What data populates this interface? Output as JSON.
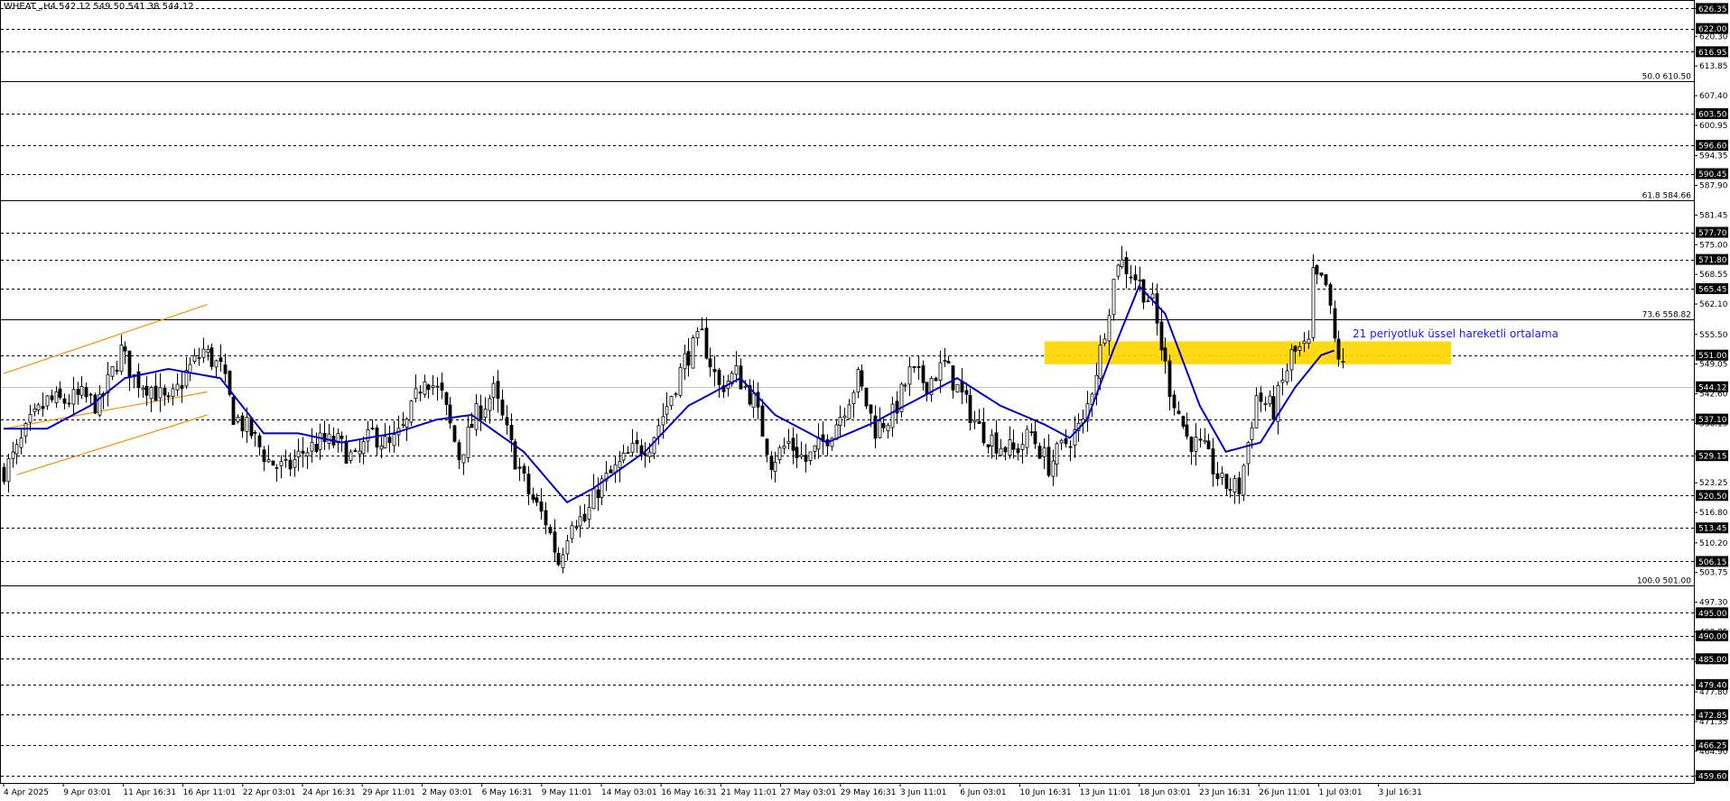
{
  "header": {
    "symbol_line": "WHEAT_,H4  542.12 549.50 541.38 544.12"
  },
  "annotation": {
    "text": "21 periyotluk üssel hareketli ortalama"
  },
  "colors": {
    "candle": "#000000",
    "ema": "#0000cc",
    "channel": "#ff8c00",
    "zone": "#ffd700",
    "grid_dashed": "#000000",
    "fib": "#000000",
    "price_tag_bg": "#000000",
    "price_tag_text": "#ffffff"
  },
  "chart_data": {
    "type": "candlestick",
    "title": "",
    "timeframe": "H4",
    "ylim": [
      458.0,
      628.0
    ],
    "y_ticks": [
      626.35,
      620.3,
      613.85,
      607.4,
      600.95,
      594.35,
      587.9,
      581.45,
      575.0,
      568.55,
      562.1,
      555.5,
      549.05,
      542.6,
      536.15,
      529.55,
      523.25,
      516.8,
      510.2,
      503.75,
      497.3,
      490.85,
      484.4,
      477.8,
      471.35,
      464.9,
      459.55
    ],
    "x_labels": [
      "4 Apr 2025",
      "9 Apr 03:01",
      "11 Apr 16:31",
      "16 Apr 11:01",
      "22 Apr 03:01",
      "24 Apr 16:31",
      "29 Apr 11:01",
      "2 May 03:01",
      "6 May 16:31",
      "9 May 11:01",
      "14 May 03:01",
      "16 May 16:31",
      "21 May 11:01",
      "27 May 03:01",
      "29 May 16:31",
      "3 Jun 11:01",
      "6 Jun 03:01",
      "10 Jun 16:31",
      "13 Jun 11:01",
      "18 Jun 03:01",
      "23 Jun 16:31",
      "26 Jun 11:01",
      "1 Jul 03:01",
      "3 Jul 16:31"
    ],
    "horizontal_levels": [
      626.35,
      622.0,
      616.95,
      603.5,
      596.6,
      590.45,
      577.7,
      571.8,
      565.45,
      551.0,
      537.1,
      529.15,
      520.5,
      513.45,
      506.15,
      495.0,
      490.0,
      485.0,
      479.4,
      472.85,
      466.25,
      459.6
    ],
    "fibonacci": [
      {
        "label": "50.0 610.50",
        "value": 610.5
      },
      {
        "label": "61.8 584.66",
        "value": 584.66
      },
      {
        "label": "73.6 558.82",
        "value": 558.82
      },
      {
        "label": "100.0 501.00",
        "value": 501.0
      }
    ],
    "current_price": {
      "label": "544.12",
      "value": 544.12
    },
    "zone": {
      "low": 549.0,
      "high": 554.0,
      "from_index": 246,
      "to_index": 334
    },
    "channel": {
      "lines": [
        {
          "from": {
            "index": 0,
            "value": 547.0
          },
          "to": {
            "index": 47,
            "value": 562.0
          }
        },
        {
          "from": {
            "index": 0,
            "value": 535.0
          },
          "to": {
            "index": 47,
            "value": 543.0
          }
        },
        {
          "from": {
            "index": 3,
            "value": 525.0
          },
          "to": {
            "index": 47,
            "value": 538.0
          }
        }
      ]
    },
    "price_anchors": [
      [
        0,
        526
      ],
      [
        3,
        530
      ],
      [
        6,
        536
      ],
      [
        10,
        541
      ],
      [
        14,
        541
      ],
      [
        18,
        542
      ],
      [
        22,
        540
      ],
      [
        27,
        552
      ],
      [
        30,
        546
      ],
      [
        34,
        544
      ],
      [
        38,
        540
      ],
      [
        42,
        547
      ],
      [
        46,
        552
      ],
      [
        50,
        548
      ],
      [
        53,
        538
      ],
      [
        57,
        534
      ],
      [
        61,
        528
      ],
      [
        65,
        526
      ],
      [
        69,
        530
      ],
      [
        73,
        532
      ],
      [
        77,
        532
      ],
      [
        81,
        528
      ],
      [
        85,
        534
      ],
      [
        89,
        531
      ],
      [
        93,
        536
      ],
      [
        97,
        547
      ],
      [
        101,
        542
      ],
      [
        105,
        529
      ],
      [
        109,
        538
      ],
      [
        113,
        543
      ],
      [
        117,
        531
      ],
      [
        121,
        521
      ],
      [
        125,
        515
      ],
      [
        128,
        506
      ],
      [
        131,
        516
      ],
      [
        134,
        515
      ],
      [
        137,
        522
      ],
      [
        141,
        526
      ],
      [
        145,
        530
      ],
      [
        149,
        532
      ],
      [
        153,
        540
      ],
      [
        157,
        550
      ],
      [
        161,
        555
      ],
      [
        165,
        544
      ],
      [
        169,
        547
      ],
      [
        173,
        541
      ],
      [
        177,
        528
      ],
      [
        181,
        532
      ],
      [
        185,
        528
      ],
      [
        189,
        532
      ],
      [
        193,
        538
      ],
      [
        197,
        546
      ],
      [
        201,
        535
      ],
      [
        205,
        538
      ],
      [
        209,
        547
      ],
      [
        213,
        545
      ],
      [
        217,
        549
      ],
      [
        221,
        542
      ],
      [
        225,
        535
      ],
      [
        229,
        532
      ],
      [
        233,
        530
      ],
      [
        237,
        534
      ],
      [
        241,
        527
      ],
      [
        245,
        532
      ],
      [
        249,
        536
      ],
      [
        253,
        552
      ],
      [
        257,
        572
      ],
      [
        261,
        568
      ],
      [
        265,
        562
      ],
      [
        269,
        544
      ],
      [
        273,
        533
      ],
      [
        277,
        530
      ],
      [
        281,
        523
      ],
      [
        285,
        522
      ],
      [
        289,
        542
      ],
      [
        293,
        539
      ],
      [
        297,
        551
      ],
      [
        301,
        553
      ],
      [
        302,
        568
      ],
      [
        305,
        566
      ],
      [
        307,
        554
      ],
      [
        309,
        548
      ]
    ],
    "ema_21": [
      [
        0,
        535
      ],
      [
        10,
        535
      ],
      [
        20,
        540
      ],
      [
        28,
        546
      ],
      [
        38,
        548
      ],
      [
        50,
        546
      ],
      [
        60,
        534
      ],
      [
        68,
        534
      ],
      [
        78,
        532
      ],
      [
        90,
        534
      ],
      [
        100,
        537
      ],
      [
        108,
        538
      ],
      [
        120,
        530
      ],
      [
        130,
        519
      ],
      [
        136,
        522
      ],
      [
        148,
        530
      ],
      [
        158,
        540
      ],
      [
        170,
        546
      ],
      [
        178,
        538
      ],
      [
        190,
        532
      ],
      [
        200,
        536
      ],
      [
        212,
        542
      ],
      [
        220,
        546
      ],
      [
        230,
        540
      ],
      [
        240,
        536
      ],
      [
        246,
        533
      ],
      [
        250,
        537
      ],
      [
        256,
        552
      ],
      [
        262,
        566
      ],
      [
        268,
        560
      ],
      [
        276,
        540
      ],
      [
        282,
        530
      ],
      [
        290,
        532
      ],
      [
        298,
        544
      ],
      [
        304,
        551
      ],
      [
        307,
        552
      ]
    ]
  }
}
